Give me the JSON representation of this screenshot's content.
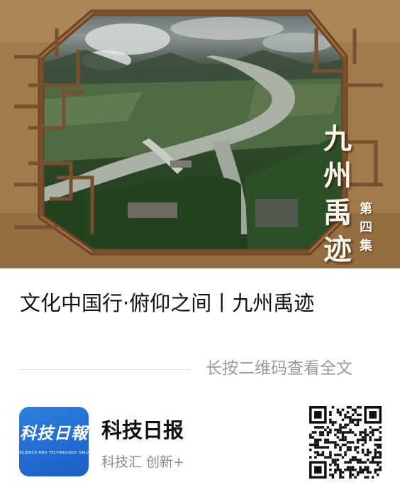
{
  "hero": {
    "vertical_title": [
      "九",
      "州",
      "禹",
      "迹"
    ],
    "episode_label": [
      "第",
      "四",
      "集"
    ]
  },
  "article": {
    "title": "文化中国行·俯仰之间丨九州禹迹"
  },
  "share": {
    "hint": "长按二维码查看全文"
  },
  "account": {
    "logo_text": "科技日報",
    "logo_subtext": "SCIENCE AND TECHNOLOGY DAILY",
    "name": "科技日报",
    "tagline": "科技汇  创新+"
  },
  "colors": {
    "frame_wood": "#7a4f2c",
    "river": "#aab2a6",
    "logo_blue": "#2366cf"
  }
}
